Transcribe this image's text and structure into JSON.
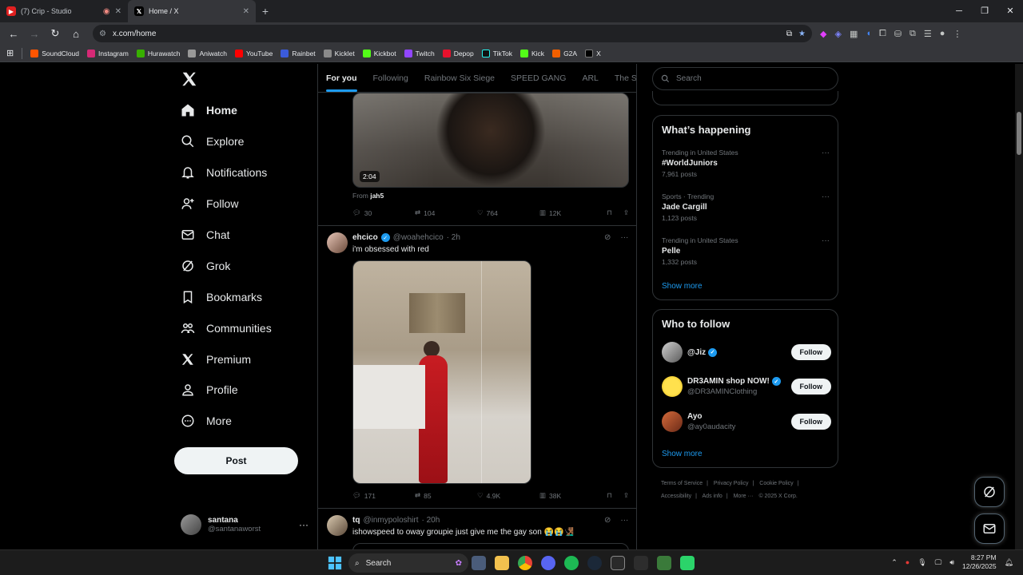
{
  "browser": {
    "tabs": [
      {
        "title": "(7) Crip - Studio",
        "active": false
      },
      {
        "title": "Home / X",
        "active": true
      }
    ],
    "url": "x.com/home",
    "bookmarks": [
      "SoundCloud",
      "Instagram",
      "Hurawatch",
      "Aniwatch",
      "YouTube",
      "Rainbet",
      "Kicklet",
      "Kickbot",
      "Twitch",
      "Depop",
      "TikTok",
      "Kick",
      "G2A",
      "X"
    ]
  },
  "nav": {
    "items": [
      {
        "label": "Home",
        "icon": "home-icon"
      },
      {
        "label": "Explore",
        "icon": "search-icon"
      },
      {
        "label": "Notifications",
        "icon": "bell-icon"
      },
      {
        "label": "Follow",
        "icon": "person-add-icon"
      },
      {
        "label": "Chat",
        "icon": "mail-icon"
      },
      {
        "label": "Grok",
        "icon": "grok-icon"
      },
      {
        "label": "Bookmarks",
        "icon": "bookmark-icon"
      },
      {
        "label": "Communities",
        "icon": "communities-icon"
      },
      {
        "label": "Premium",
        "icon": "x-logo-icon"
      },
      {
        "label": "Profile",
        "icon": "person-icon"
      },
      {
        "label": "More",
        "icon": "more-circle-icon"
      }
    ],
    "post_label": "Post",
    "account": {
      "name": "santana",
      "handle": "@santanaworst"
    }
  },
  "feed": {
    "tabs": [
      "For you",
      "Following",
      "Rainbow Six Siege",
      "SPEED GANG",
      "ARL",
      "The Stabl"
    ],
    "post1": {
      "video_duration": "2:04",
      "from_prefix": "From",
      "from_user": "jah5",
      "replies": "30",
      "reposts": "104",
      "likes": "764",
      "views": "12K"
    },
    "post2": {
      "name": "ehcico",
      "handle": "@woahehcico",
      "time": "· 2h",
      "text": "i'm obsessed with red",
      "replies": "171",
      "reposts": "85",
      "likes": "4.9K",
      "views": "38K"
    },
    "post3": {
      "name": "tq",
      "handle": "@inmypoloshirt",
      "time": "· 20h",
      "text": "ishowspeed to oway groupie just give me the gay son 😭😭🧏🏾‍♂️"
    }
  },
  "sidebar": {
    "search_placeholder": "Search",
    "trending_title": "What’s happening",
    "trends": [
      {
        "context": "Trending in United States",
        "topic": "#WorldJuniors",
        "posts": "7,961 posts"
      },
      {
        "context": "Sports · Trending",
        "topic": "Jade Cargill",
        "posts": "1,123 posts"
      },
      {
        "context": "Trending in United States",
        "topic": "Pelle",
        "posts": "1,332 posts"
      }
    ],
    "show_more": "Show more",
    "wtf_title": "Who to follow",
    "who_to_follow": [
      {
        "name": "@Jiz",
        "handle": "",
        "button": "Follow"
      },
      {
        "name": "DR3AMIN shop NOW!",
        "handle": "@DR3AMINClothing",
        "button": "Follow"
      },
      {
        "name": "Ayo",
        "handle": "@ay0audacity",
        "button": "Follow"
      }
    ],
    "footer": [
      "Terms of Service",
      "|",
      "Privacy Policy",
      "|",
      "Cookie Policy",
      "|",
      "Accessibility",
      "|",
      "Ads info",
      "|",
      "More ···",
      "© 2025 X Corp."
    ]
  },
  "taskbar": {
    "search_label": "Search",
    "time": "8:27 PM",
    "date": "12/26/2025"
  }
}
